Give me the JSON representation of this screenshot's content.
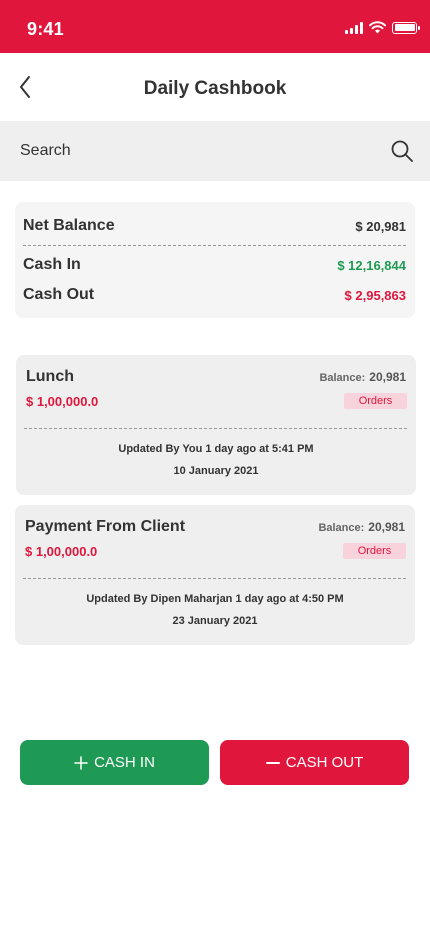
{
  "status_bar": {
    "time": "9:41",
    "color": "#e0163d"
  },
  "header": {
    "title": "Daily Cashbook",
    "back_icon": "chevron-left-icon"
  },
  "search": {
    "placeholder": "Search",
    "icon": "search-icon"
  },
  "summary": {
    "net_balance_label": "Net Balance",
    "net_balance_value": "$ 20,981",
    "cash_in_label": "Cash In",
    "cash_in_value": "$ 12,16,844",
    "cash_out_label": "Cash Out",
    "cash_out_value": "$ 2,95,863",
    "colors": {
      "cash_in": "#1f9a54",
      "cash_out": "#e0163d"
    }
  },
  "entries": [
    {
      "title": "Lunch",
      "amount": "$ 1,00,000.0",
      "balance_label": "Balance:",
      "balance_value": "20,981",
      "tag": "Orders",
      "updated": "Updated By You 1 day ago at 5:41 PM",
      "date": "10 January 2021"
    },
    {
      "title": "Payment From Client",
      "amount": "$ 1,00,000.0",
      "balance_label": "Balance:",
      "balance_value": "20,981",
      "tag": "Orders",
      "updated": "Updated By Dipen Maharjan 1 day ago at 4:50 PM",
      "date": "23 January 2021"
    }
  ],
  "actions": {
    "cash_in_label": "CASH IN",
    "cash_out_label": "CASH OUT",
    "cash_in_icon": "plus-icon",
    "cash_out_icon": "minus-icon"
  }
}
